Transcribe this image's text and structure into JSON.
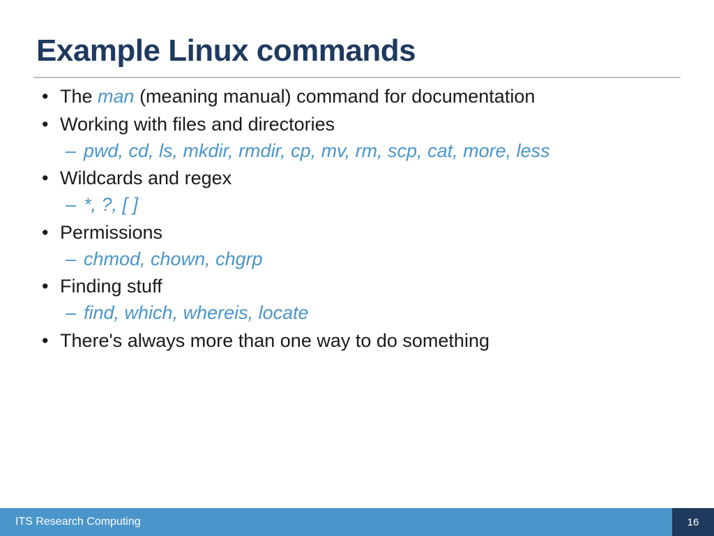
{
  "title": "Example Linux commands",
  "bullets": {
    "b1_prefix": "The ",
    "b1_emph": "man",
    "b1_suffix": " (meaning manual) command for documentation",
    "b2": "Working with files and directories",
    "b2_sub": "pwd, cd, ls, mkdir, rmdir, cp, mv, rm, scp, cat, more, less",
    "b3": "Wildcards and regex",
    "b3_sub": "*, ?, [ ]",
    "b4": "Permissions",
    "b4_sub": "chmod, chown, chgrp",
    "b5": "Finding stuff",
    "b5_sub": "find, which, whereis, locate",
    "b6": "There's always more than one way to do something"
  },
  "footer": {
    "label": "ITS Research Computing",
    "page": "16"
  }
}
